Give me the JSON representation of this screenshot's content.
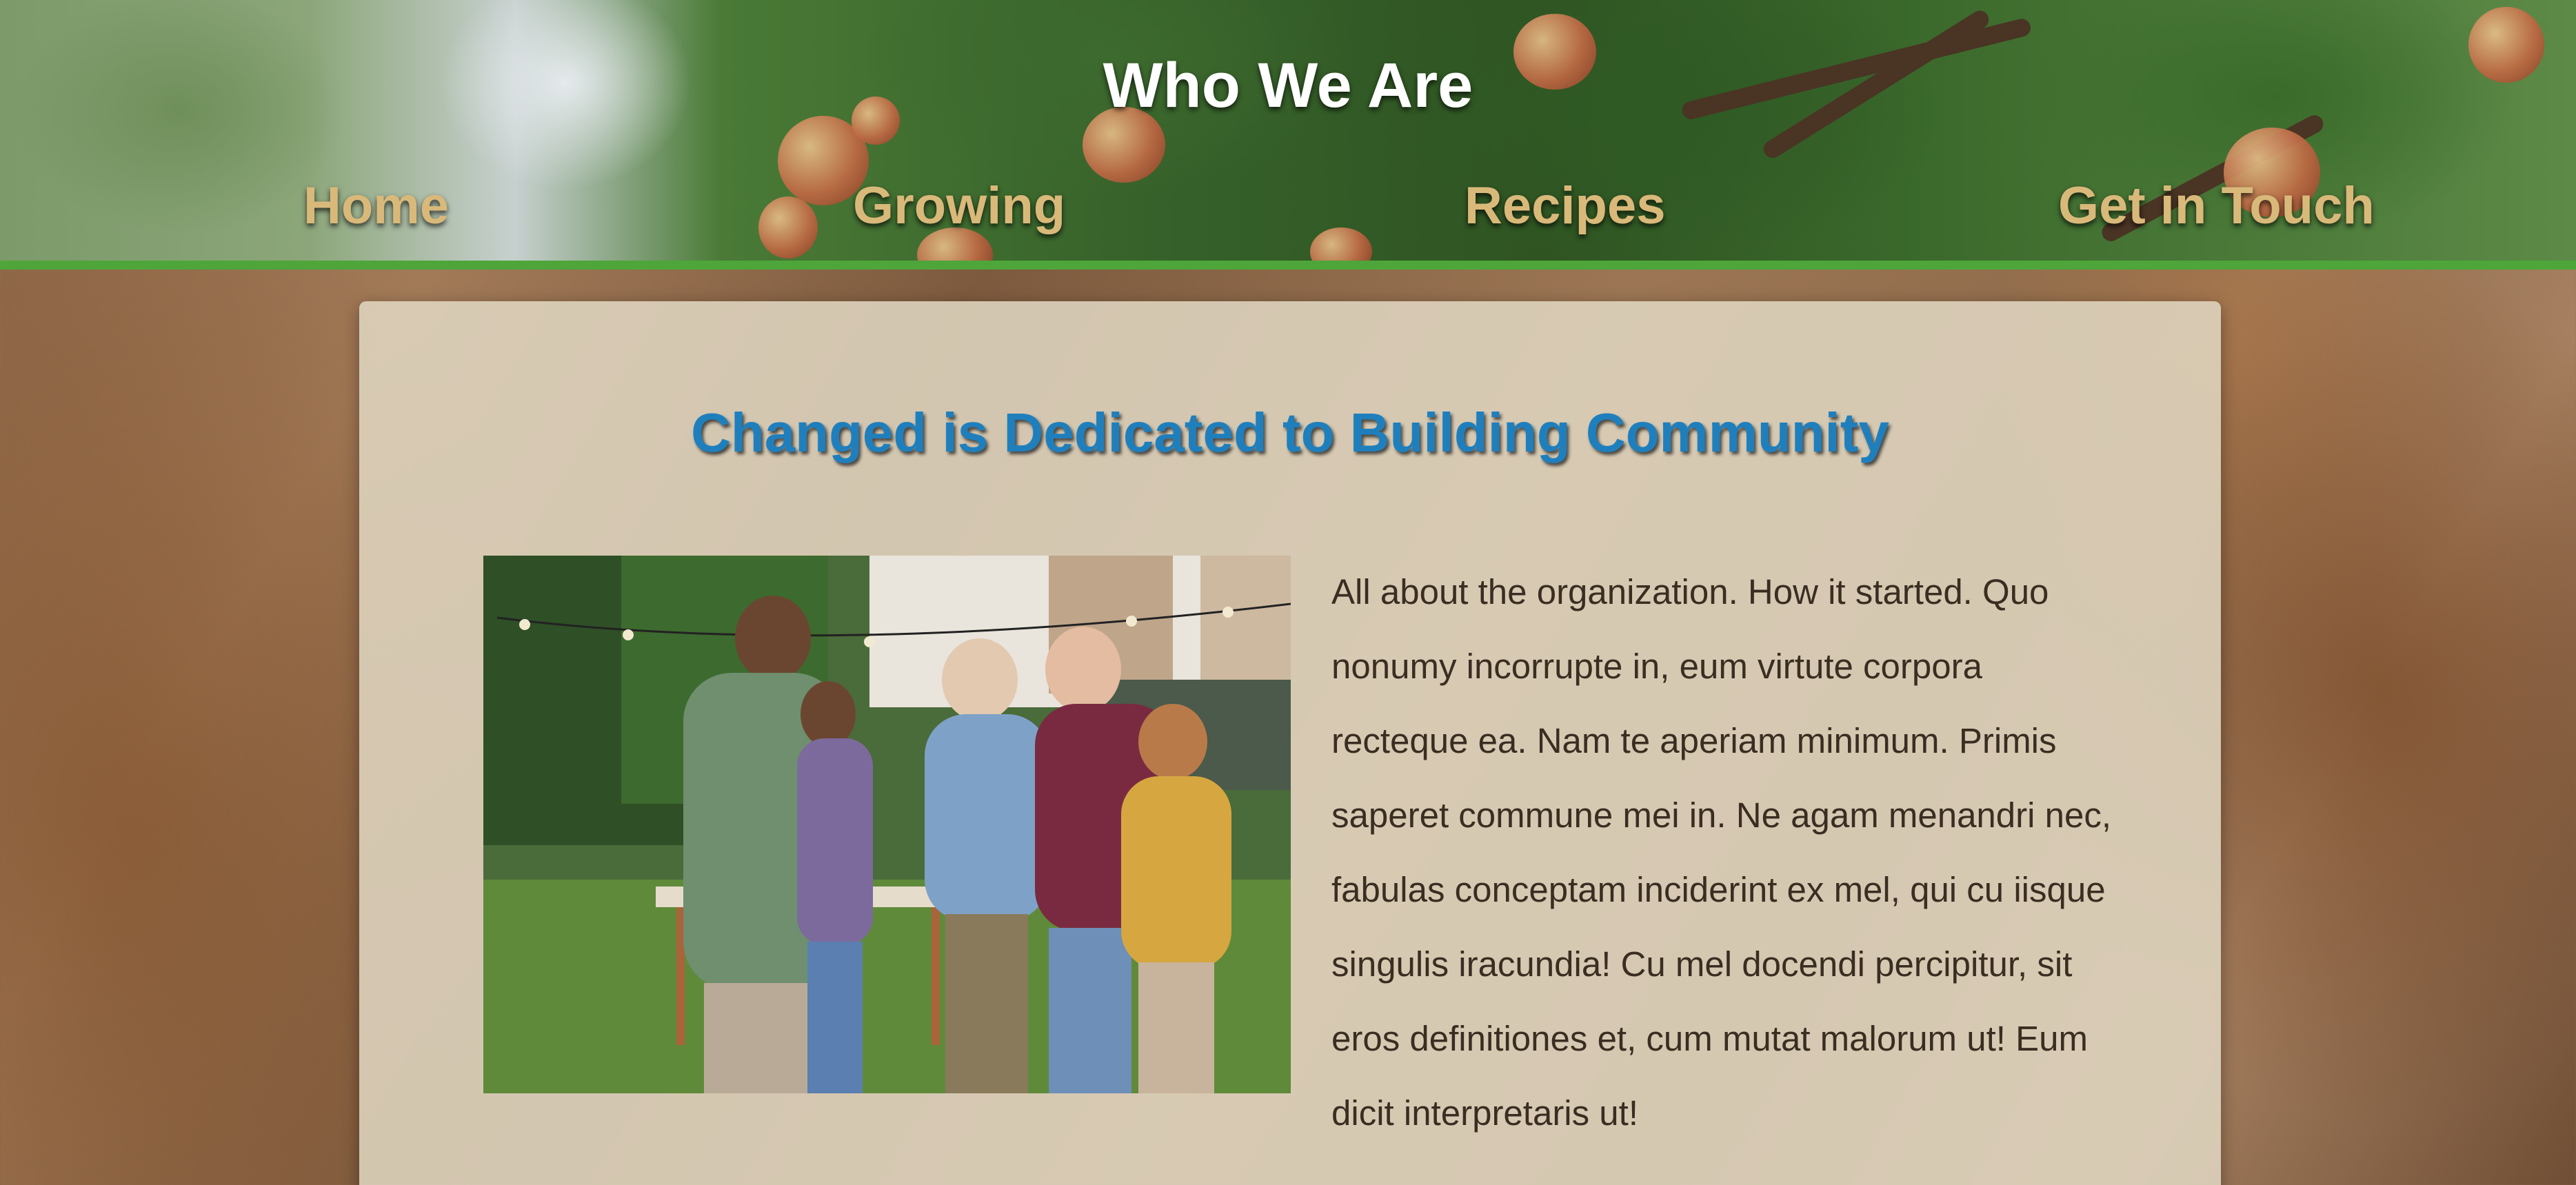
{
  "header": {
    "title": "Who We Are",
    "nav": [
      {
        "label": "Home"
      },
      {
        "label": "Growing"
      },
      {
        "label": "Recipes"
      },
      {
        "label": "Get in Touch"
      }
    ],
    "accent_color": "#4ea53a",
    "nav_color": "#d9b97a"
  },
  "main": {
    "heading": "Changed is Dedicated to Building Community",
    "heading_color": "#1f7fbd",
    "body": "All about the organization. How it started. Quo nonumy incorrupte in, eum virtute corpora recteque ea. Nam te aperiam minimum. Primis saperet commune mei in. Ne agam menandri nec, fabulas conceptam inciderint ex mel, qui cu iisque singulis iracundia! Cu mel docendi percipitur, sit eros definitiones et, cum mutat malorum ut! Eum dicit interpretaris ut!"
  }
}
